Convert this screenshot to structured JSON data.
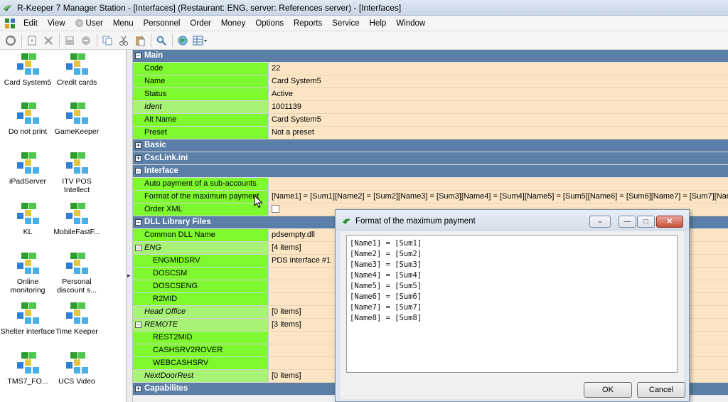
{
  "window": {
    "title": "R-Keeper 7 Manager Station - [Interfaces] (Restaurant: ENG, server: References server) - [Interfaces]"
  },
  "menubar": {
    "items": [
      "Edit",
      "View",
      "User",
      "Menu",
      "Personnel",
      "Order",
      "Money",
      "Options",
      "Reports",
      "Service",
      "Help",
      "Window"
    ]
  },
  "toolbar": {
    "icons": [
      "refresh-icon",
      "new-icon",
      "delete-icon",
      "save-icon",
      "cancel-icon",
      "copy-icon",
      "cut-icon",
      "paste-icon",
      "find-icon",
      "globe-icon",
      "view-grid-icon"
    ]
  },
  "left_panel": {
    "items": [
      {
        "label": "Card System5"
      },
      {
        "label": "Credit cards"
      },
      {
        "label": "Do not print"
      },
      {
        "label": "GameKeeper"
      },
      {
        "label": "iPadServer"
      },
      {
        "label": "ITV POS Intellect"
      },
      {
        "label": "KL"
      },
      {
        "label": "MobileFastF..."
      },
      {
        "label": "Online monitoring"
      },
      {
        "label": "Personal discount s..."
      },
      {
        "label": "Shelter interface"
      },
      {
        "label": "Time Keeper"
      },
      {
        "label": "TMS7_FO..."
      },
      {
        "label": "UCS Video"
      }
    ]
  },
  "grid": {
    "main": {
      "label": "Main",
      "code_name": "Code",
      "code_value": "22",
      "name_name": "Name",
      "name_value": "Card System5",
      "status_name": "Status",
      "status_value": "Active",
      "ident_name": "Ident",
      "ident_value": "1001139",
      "altname_name": "Alt Name",
      "altname_value": "Card System5",
      "preset_name": "Preset",
      "preset_value": "Not a preset"
    },
    "basic": {
      "label": "Basic"
    },
    "csclink": {
      "label": "CscLink.ini"
    },
    "interface": {
      "label": "Interface",
      "autopay_name": "Auto payment of a sub-accounts",
      "autopay_value": "",
      "format_name": "Format of the maximum payment",
      "format_value": "[Name1] = [Sum1][Name2] = [Sum2][Name3] = [Sum3][Name4] = [Sum4][Name5] = [Sum5][Name6] = [Sum6][Name7] = [Sum7][Name8] = [Sum8]",
      "orderxml_name": "Order XML"
    },
    "dll": {
      "label": "DLL Library Files",
      "common_name": "Common DLL Name",
      "common_value": "pdsempty.dll",
      "eng_name": "ENG",
      "eng_value": "[4 items]",
      "engmidsrv_name": "ENGMIDSRV",
      "engmidsrv_value": "PDS interface #1",
      "doscsm_name": "DOSCSM",
      "doscseng_name": "DOSCSENG",
      "r2mid_name": "R2MID",
      "headoffice_name": "Head Office",
      "headoffice_value": "[0 items]",
      "remote_name": "REMOTE",
      "remote_value": "[3 items]",
      "rest2mid_name": "REST2MID",
      "cashsrv_name": "CASHSRV2ROVER",
      "webcash_name": "WEBCASHSRV",
      "nextdoor_name": "NextDoorRest",
      "nextdoor_value": "[0 items]"
    },
    "capabilites": {
      "label": "Capabilites"
    }
  },
  "dialog": {
    "title": "Format of the maximum payment",
    "lines": [
      "[Name1] = [Sum1]",
      "[Name2] = [Sum2]",
      "[Name3] = [Sum3]",
      "[Name4] = [Sum4]",
      "[Name5] = [Sum5]",
      "[Name6] = [Sum6]",
      "[Name7] = [Sum7]",
      "[Name8] = [Sum8]"
    ],
    "ok_label": "OK",
    "cancel_label": "Cancel"
  },
  "colors": {
    "category": "#5b7fa6",
    "name_cell": "#7ef92f",
    "name_cell_light": "#a8f277",
    "value_cell": "#fbe5c4"
  }
}
